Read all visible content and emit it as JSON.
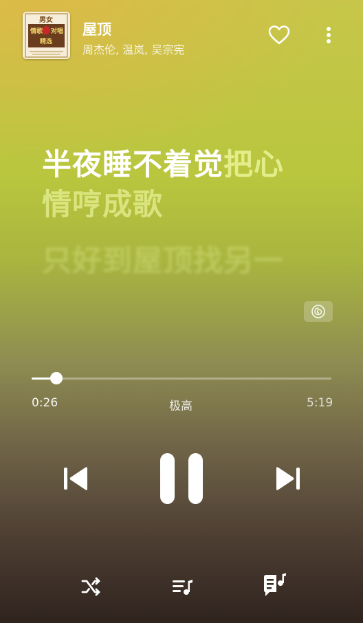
{
  "song": {
    "title": "屋顶",
    "artists": "周杰伦, 温岚, 吴宗宪"
  },
  "cover": {
    "text_line1": "男女",
    "text_line2": "情歌",
    "text_line3": "对唱",
    "text_line4": "精选"
  },
  "lyrics": {
    "current_sung": "半夜睡不着觉",
    "current_unsung": "把心",
    "next": "情哼成歌",
    "after": "只好到屋顶找另一"
  },
  "progress": {
    "current_time": "0:26",
    "quality": "极高",
    "total_time": "5:19",
    "fraction": 0.0815
  },
  "icons": {
    "like": "heart-outline-icon",
    "more": "more-vertical-icon",
    "badge": "netease-logo-icon",
    "prev": "skip-previous-icon",
    "pause": "pause-icon",
    "next": "skip-next-icon",
    "shuffle": "shuffle-icon",
    "playlist": "playlist-icon",
    "lyrics": "lyrics-icon"
  },
  "colors": {
    "accent_lyric_pending": "#e2ee8a",
    "foreground": "#ffffff"
  }
}
